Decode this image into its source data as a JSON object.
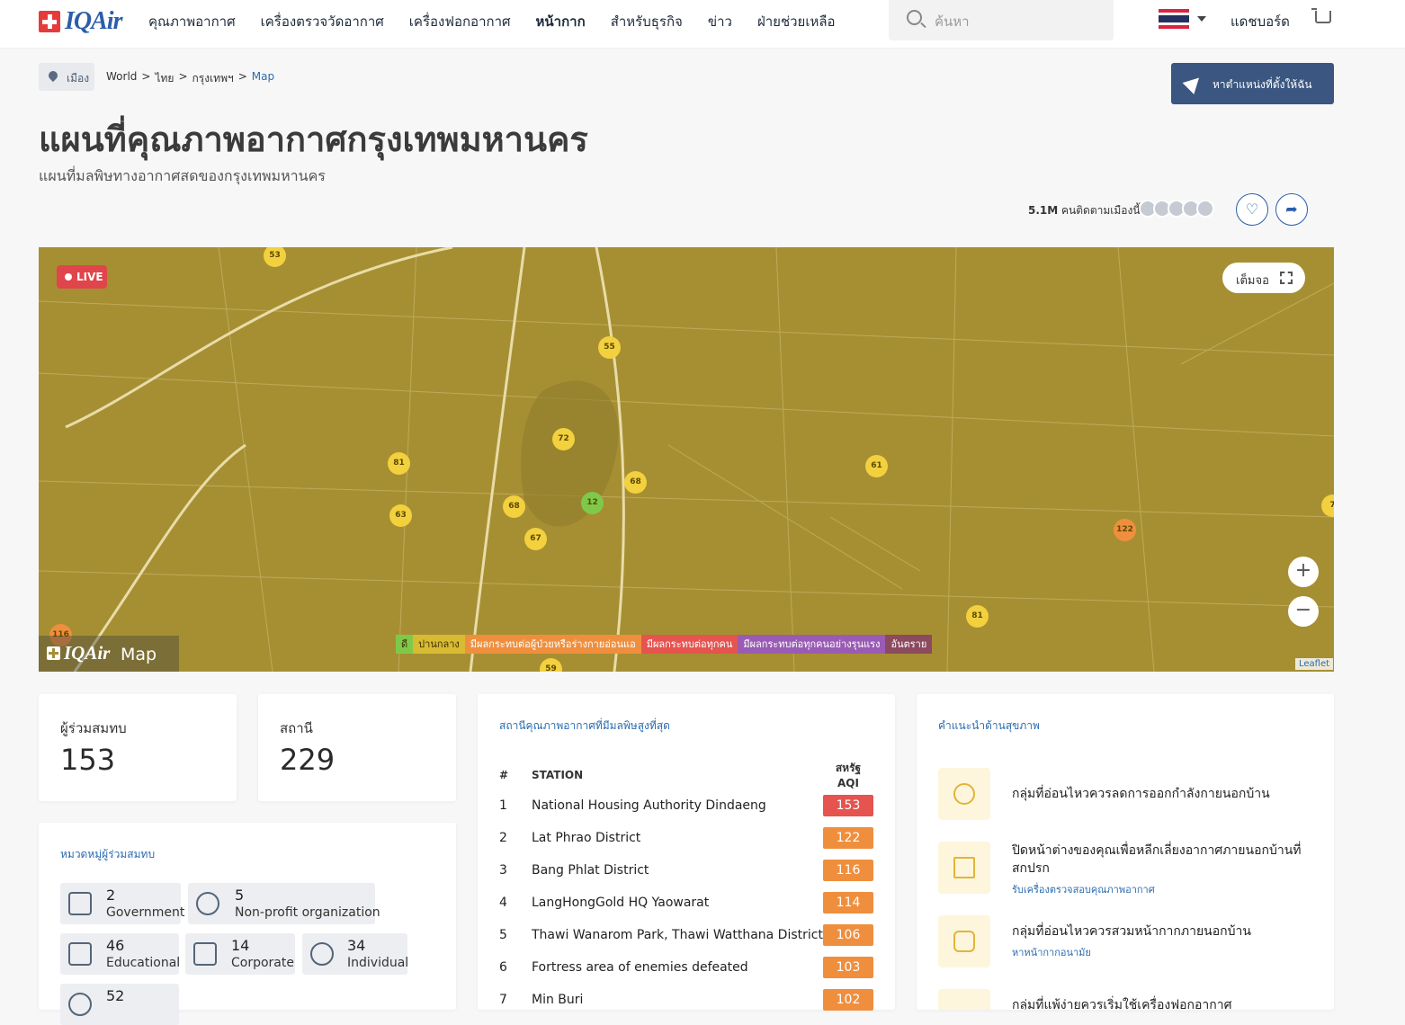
{
  "header": {
    "logo": "IQAir",
    "menu": [
      "คุณภาพอากาศ",
      "เครื่องตรวจวัดอากาศ",
      "เครื่องฟอกอากาศ",
      "หน้ากาก",
      "สำหรับธุรกิจ",
      "ข่าว",
      "ฝ่ายช่วยเหลือ"
    ],
    "search_placeholder": "ค้นหา",
    "dashboard": "แดชบอร์ด"
  },
  "breadcrumb": {
    "tag": "เมือง",
    "items": [
      "World",
      ">",
      "ไทย",
      ">",
      "กรุงเทพฯ",
      ">",
      "Map"
    ]
  },
  "locate_button": "หาตำแหน่งที่ตั้งให้ฉัน",
  "title": "แผนที่คุณภาพอากาศกรุงเทพมหานคร",
  "subtitle": "แผนที่มลพิษทางอากาศสดของกรุงเทพมหานคร",
  "followers": {
    "count": "5.1M",
    "text": "คนติดตามเมืองนี้"
  },
  "map": {
    "live": "LIVE",
    "fullscreen": "เต็มจอ",
    "markers": [
      {
        "v": "53",
        "c": "#f3d03e"
      },
      {
        "v": "55",
        "c": "#f3d03e"
      },
      {
        "v": "72",
        "c": "#f3d03e"
      },
      {
        "v": "81",
        "c": "#f3d03e"
      },
      {
        "v": "63",
        "c": "#f3d03e"
      },
      {
        "v": "68",
        "c": "#f3d03e"
      },
      {
        "v": "12",
        "c": "#7fc94a"
      },
      {
        "v": "68",
        "c": "#f3d03e"
      },
      {
        "v": "67",
        "c": "#f3d03e"
      },
      {
        "v": "61",
        "c": "#f3d03e"
      },
      {
        "v": "122",
        "c": "#ef8f3e"
      },
      {
        "v": "81",
        "c": "#f3d03e"
      },
      {
        "v": "116",
        "c": "#ef8f3e"
      },
      {
        "v": "59",
        "c": "#f3d03e"
      },
      {
        "v": "7",
        "c": "#f3d03e"
      }
    ],
    "legend": [
      {
        "label": "ดี",
        "color": "#7fc94a"
      },
      {
        "label": "ปานกลาง",
        "color": "#d9bb32"
      },
      {
        "label": "มีผลกระทบต่อผู้ป่วยหรือร่างกายอ่อนแอ",
        "color": "#ef8f3e"
      },
      {
        "label": "มีผลกระทบต่อทุกคน",
        "color": "#e5544f"
      },
      {
        "label": "มีผลกระทบต่อทุกคนอย่างรุนแรง",
        "color": "#9a5bb5"
      },
      {
        "label": "อันตราย",
        "color": "#8c4a5e"
      }
    ],
    "brand": "IQAir",
    "brand_suffix": "Map",
    "attribution": "Leaflet"
  },
  "stats": {
    "contributors_label": "ผู้ร่วมสมทบ",
    "contributors": "153",
    "stations_label": "สถานี",
    "stations": "229"
  },
  "contributor_categories": {
    "title": "หมวดหมู่ผู้ร่วมสมทบ",
    "items": [
      {
        "count": "2",
        "label": "Government",
        "icon": "government-icon"
      },
      {
        "count": "5",
        "label": "Non-profit organization",
        "icon": "nonprofit-icon"
      },
      {
        "count": "46",
        "label": "Educational",
        "icon": "graduation-cap-icon"
      },
      {
        "count": "14",
        "label": "Corporate",
        "icon": "briefcase-icon"
      },
      {
        "count": "34",
        "label": "Individual",
        "icon": "person-icon"
      },
      {
        "count": "52",
        "label": "",
        "icon": "person-icon"
      }
    ]
  },
  "ranking": {
    "title": "สถานีคุณภาพอากาศที่มีมลพิษสูงที่สุด",
    "headers": [
      "#",
      "STATION",
      "สหรัฐ AQI"
    ],
    "rows": [
      {
        "rank": "1",
        "station": "National Housing Authority Dindaeng",
        "aqi": "153",
        "color": "#e5544f"
      },
      {
        "rank": "2",
        "station": "Lat Phrao District",
        "aqi": "122",
        "color": "#ef8f3e"
      },
      {
        "rank": "3",
        "station": "Bang Phlat District",
        "aqi": "116",
        "color": "#ef8f3e"
      },
      {
        "rank": "4",
        "station": "LangHongGold HQ Yaowarat",
        "aqi": "114",
        "color": "#ef8f3e"
      },
      {
        "rank": "5",
        "station": "Thawi Wanarom Park, Thawi Watthana District",
        "aqi": "106",
        "color": "#ef8f3e"
      },
      {
        "rank": "6",
        "station": "Fortress area of enemies defeated",
        "aqi": "103",
        "color": "#ef8f3e"
      },
      {
        "rank": "7",
        "station": "Min Buri",
        "aqi": "102",
        "color": "#ef8f3e"
      }
    ]
  },
  "health": {
    "title": "คำแนะนำด้านสุขภาพ",
    "items": [
      {
        "text": "กลุ่มที่อ่อนไหวควรลดการออกกำลังกายนอกบ้าน",
        "link": "",
        "icon": "bicycle-icon"
      },
      {
        "text": "ปิดหน้าต่างของคุณเพื่อหลีกเลี่ยงอากาศภายนอกบ้านที่สกปรก",
        "link": "รับเครื่องตรวจสอบคุณภาพอากาศ",
        "icon": "window-icon"
      },
      {
        "text": "กลุ่มที่อ่อนไหวควรสวมหน้ากากภายนอกบ้าน",
        "link": "หาหน้ากากอนามัย",
        "icon": "mask-icon"
      },
      {
        "text": "กลุ่มที่แพ้ง่ายควรเริ่มใช้เครื่องฟอกอากาศ",
        "link": "",
        "icon": "purifier-icon"
      }
    ]
  }
}
